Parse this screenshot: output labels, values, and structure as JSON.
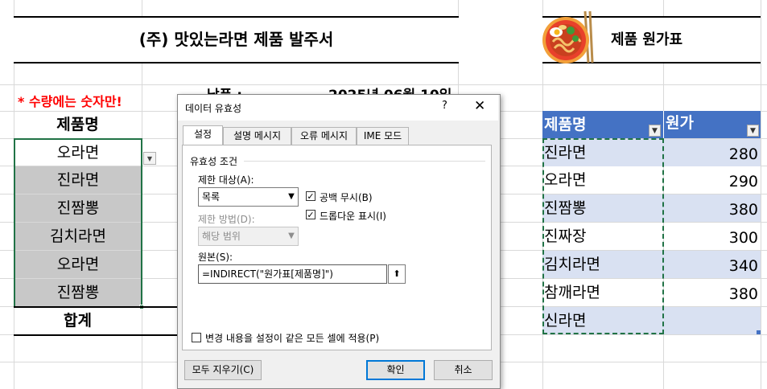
{
  "sheet": {
    "order_title": "(주) 맛있는라면 제품 발주서",
    "note": "* 수량에는 숫자만!",
    "date_label": "납품 :",
    "date_value": "2025년 06월 10일",
    "product_header": "제품명",
    "order_items": [
      "오라면",
      "진라면",
      "진짬뽕",
      "김치라면",
      "오라면",
      "진짬뽕"
    ],
    "total_label": "합계",
    "price_title": "제품 원가표",
    "price_table": {
      "headers": [
        "제품명",
        "원가"
      ],
      "rows": [
        {
          "name": "진라면",
          "price": "280"
        },
        {
          "name": "오라면",
          "price": "290"
        },
        {
          "name": "진짬뽕",
          "price": "380"
        },
        {
          "name": "진짜장",
          "price": "300"
        },
        {
          "name": "김치라면",
          "price": "340"
        },
        {
          "name": "참깨라면",
          "price": "380"
        },
        {
          "name": "신라면",
          "price": ""
        }
      ]
    },
    "colors": {
      "header_blue": "#4472c4",
      "band_blue": "#d9e1f2",
      "note_red": "#ff0000",
      "selection_green": "#217346"
    }
  },
  "dialog": {
    "title": "데이터 유효성",
    "help": "?",
    "close": "✕",
    "tabs": [
      "설정",
      "설명 메시지",
      "오류 메시지",
      "IME 모드"
    ],
    "criteria_group": "유효성 조건",
    "allow_label": "제한 대상(A):",
    "allow_value": "목록",
    "ignore_blank": "공백 무시(B)",
    "in_cell_dropdown": "드롭다운 표시(I)",
    "data_label": "제한 방법(D):",
    "data_value": "해당 범위",
    "source_label": "원본(S):",
    "source_value": "=INDIRECT(\"원가표[제품명]\")",
    "apply_all": "변경 내용을 설정이 같은 모든 셀에 적용(P)",
    "clear_all": "모두 지우기(C)",
    "ok": "확인",
    "cancel": "취소"
  },
  "icons": {
    "ramen": "ramen-bowl-icon",
    "dropdown": "chevron-down-icon",
    "collapse": "collapse-dialog-icon"
  }
}
